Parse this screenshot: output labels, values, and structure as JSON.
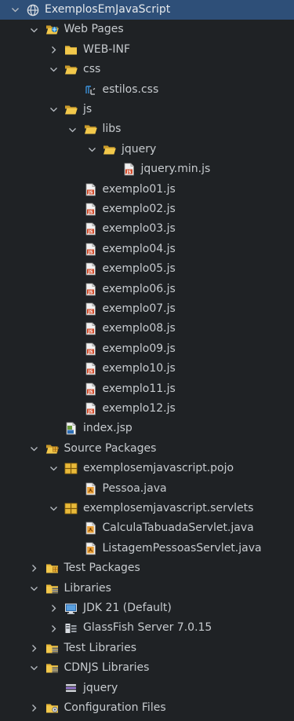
{
  "colors": {
    "background": "#1f2225",
    "selection": "#2e4f78",
    "text": "#c7cbcf",
    "folder": "#e8b93a"
  },
  "tree": [
    {
      "label": "ExemplosEmJavaScript",
      "depth": 0,
      "toggle": "expanded",
      "icon": "globe-project-icon",
      "selected": true
    },
    {
      "label": "Web Pages",
      "depth": 1,
      "toggle": "expanded",
      "icon": "web-pages-folder-icon"
    },
    {
      "label": "WEB-INF",
      "depth": 2,
      "toggle": "collapsed",
      "icon": "folder-icon"
    },
    {
      "label": "css",
      "depth": 2,
      "toggle": "expanded",
      "icon": "folder-open-icon"
    },
    {
      "label": "estilos.css",
      "depth": 3,
      "toggle": "none",
      "icon": "css-file-icon"
    },
    {
      "label": "js",
      "depth": 2,
      "toggle": "expanded",
      "icon": "folder-open-icon"
    },
    {
      "label": "libs",
      "depth": 3,
      "toggle": "expanded",
      "icon": "folder-open-icon"
    },
    {
      "label": "jquery",
      "depth": 4,
      "toggle": "expanded",
      "icon": "folder-open-icon"
    },
    {
      "label": "jquery.min.js",
      "depth": 5,
      "toggle": "none",
      "icon": "js-file-icon"
    },
    {
      "label": "exemplo01.js",
      "depth": 3,
      "toggle": "none",
      "icon": "js-file-icon"
    },
    {
      "label": "exemplo02.js",
      "depth": 3,
      "toggle": "none",
      "icon": "js-file-icon"
    },
    {
      "label": "exemplo03.js",
      "depth": 3,
      "toggle": "none",
      "icon": "js-file-icon"
    },
    {
      "label": "exemplo04.js",
      "depth": 3,
      "toggle": "none",
      "icon": "js-file-icon"
    },
    {
      "label": "exemplo05.js",
      "depth": 3,
      "toggle": "none",
      "icon": "js-file-icon"
    },
    {
      "label": "exemplo06.js",
      "depth": 3,
      "toggle": "none",
      "icon": "js-file-icon"
    },
    {
      "label": "exemplo07.js",
      "depth": 3,
      "toggle": "none",
      "icon": "js-file-icon"
    },
    {
      "label": "exemplo08.js",
      "depth": 3,
      "toggle": "none",
      "icon": "js-file-icon"
    },
    {
      "label": "exemplo09.js",
      "depth": 3,
      "toggle": "none",
      "icon": "js-file-icon"
    },
    {
      "label": "exemplo10.js",
      "depth": 3,
      "toggle": "none",
      "icon": "js-file-icon"
    },
    {
      "label": "exemplo11.js",
      "depth": 3,
      "toggle": "none",
      "icon": "js-file-icon"
    },
    {
      "label": "exemplo12.js",
      "depth": 3,
      "toggle": "none",
      "icon": "js-file-icon"
    },
    {
      "label": "index.jsp",
      "depth": 2,
      "toggle": "none",
      "icon": "jsp-file-icon"
    },
    {
      "label": "Source Packages",
      "depth": 1,
      "toggle": "expanded",
      "icon": "source-packages-folder-icon"
    },
    {
      "label": "exemplosemjavascript.pojo",
      "depth": 2,
      "toggle": "expanded",
      "icon": "package-icon"
    },
    {
      "label": "Pessoa.java",
      "depth": 3,
      "toggle": "none",
      "icon": "java-file-icon"
    },
    {
      "label": "exemplosemjavascript.servlets",
      "depth": 2,
      "toggle": "expanded",
      "icon": "package-icon"
    },
    {
      "label": "CalculaTabuadaServlet.java",
      "depth": 3,
      "toggle": "none",
      "icon": "java-file-icon"
    },
    {
      "label": "ListagemPessoasServlet.java",
      "depth": 3,
      "toggle": "none",
      "icon": "java-file-icon"
    },
    {
      "label": "Test Packages",
      "depth": 1,
      "toggle": "collapsed",
      "icon": "test-packages-folder-icon"
    },
    {
      "label": "Libraries",
      "depth": 1,
      "toggle": "expanded",
      "icon": "libraries-folder-icon"
    },
    {
      "label": "JDK 21 (Default)",
      "depth": 2,
      "toggle": "collapsed",
      "icon": "jdk-monitor-icon"
    },
    {
      "label": "GlassFish Server 7.0.15",
      "depth": 2,
      "toggle": "collapsed",
      "icon": "server-library-icon"
    },
    {
      "label": "Test Libraries",
      "depth": 1,
      "toggle": "collapsed",
      "icon": "libraries-folder-icon"
    },
    {
      "label": "CDNJS Libraries",
      "depth": 1,
      "toggle": "expanded",
      "icon": "libraries-folder-icon"
    },
    {
      "label": "jquery",
      "depth": 2,
      "toggle": "none",
      "icon": "library-stack-icon"
    },
    {
      "label": "Configuration Files",
      "depth": 1,
      "toggle": "collapsed",
      "icon": "configuration-folder-icon"
    }
  ]
}
